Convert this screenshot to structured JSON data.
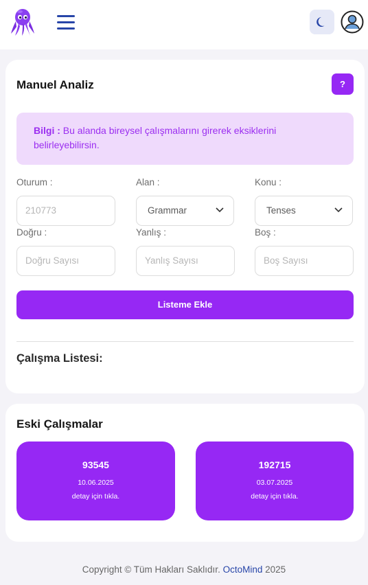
{
  "header": {
    "logo_icon": "octopus-icon",
    "menu_icon": "hamburger-icon",
    "theme_icon": "moon-icon",
    "avatar_icon": "user-circle-icon"
  },
  "manual": {
    "title": "Manuel Analiz",
    "help_label": "?",
    "info_label": "Bilgi :",
    "info_text": "Bu alanda bireysel çalışmalarını girerek eksiklerini belirleyebilirsin.",
    "session_label": "Oturum :",
    "session_placeholder": "210773",
    "area_label": "Alan :",
    "area_value": "Grammar",
    "topic_label": "Konu :",
    "topic_value": "Tenses",
    "correct_label": "Doğru :",
    "correct_placeholder": "Doğru Sayısı",
    "wrong_label": "Yanlış :",
    "wrong_placeholder": "Yanlış Sayısı",
    "empty_label": "Boş :",
    "empty_placeholder": "Boş Sayısı",
    "submit_label": "Listeme Ekle",
    "list_title": "Çalışma Listesi:"
  },
  "old": {
    "title": "Eski Çalışmalar",
    "items": [
      {
        "id": "93545",
        "date": "10.06.2025",
        "hint": "detay için tıkla."
      },
      {
        "id": "192715",
        "date": "03.07.2025",
        "hint": "detay için tıkla."
      }
    ]
  },
  "footer": {
    "copyright": "Copyright © Tüm Hakları Saklıdır.",
    "brand": "OctoMind",
    "year": "2025"
  },
  "colors": {
    "accent": "#9628f4",
    "brand_blue": "#2745a8",
    "info_bg": "#efdafc"
  }
}
